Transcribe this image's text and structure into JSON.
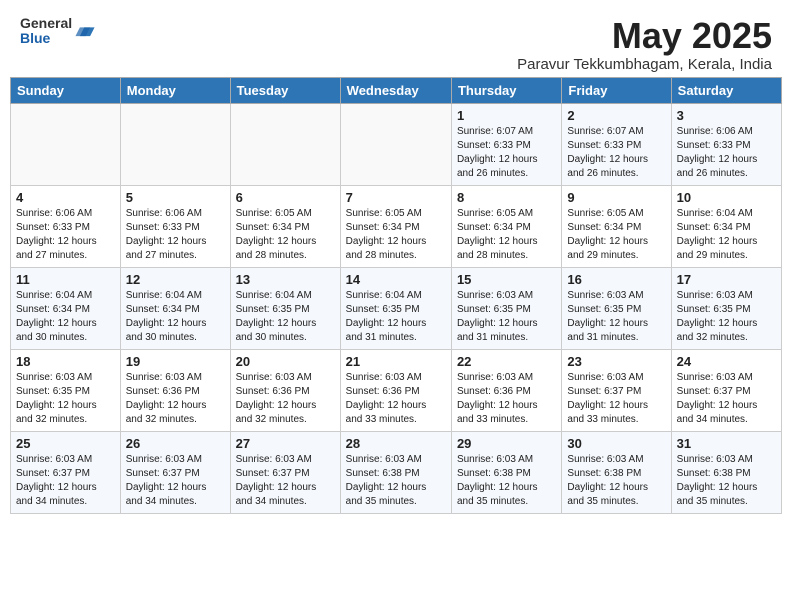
{
  "header": {
    "logo_general": "General",
    "logo_blue": "Blue",
    "month_year": "May 2025",
    "location": "Paravur Tekkumbhagam, Kerala, India"
  },
  "days_of_week": [
    "Sunday",
    "Monday",
    "Tuesday",
    "Wednesday",
    "Thursday",
    "Friday",
    "Saturday"
  ],
  "weeks": [
    [
      {
        "day": "",
        "info": ""
      },
      {
        "day": "",
        "info": ""
      },
      {
        "day": "",
        "info": ""
      },
      {
        "day": "",
        "info": ""
      },
      {
        "day": "1",
        "info": "Sunrise: 6:07 AM\nSunset: 6:33 PM\nDaylight: 12 hours\nand 26 minutes."
      },
      {
        "day": "2",
        "info": "Sunrise: 6:07 AM\nSunset: 6:33 PM\nDaylight: 12 hours\nand 26 minutes."
      },
      {
        "day": "3",
        "info": "Sunrise: 6:06 AM\nSunset: 6:33 PM\nDaylight: 12 hours\nand 26 minutes."
      }
    ],
    [
      {
        "day": "4",
        "info": "Sunrise: 6:06 AM\nSunset: 6:33 PM\nDaylight: 12 hours\nand 27 minutes."
      },
      {
        "day": "5",
        "info": "Sunrise: 6:06 AM\nSunset: 6:33 PM\nDaylight: 12 hours\nand 27 minutes."
      },
      {
        "day": "6",
        "info": "Sunrise: 6:05 AM\nSunset: 6:34 PM\nDaylight: 12 hours\nand 28 minutes."
      },
      {
        "day": "7",
        "info": "Sunrise: 6:05 AM\nSunset: 6:34 PM\nDaylight: 12 hours\nand 28 minutes."
      },
      {
        "day": "8",
        "info": "Sunrise: 6:05 AM\nSunset: 6:34 PM\nDaylight: 12 hours\nand 28 minutes."
      },
      {
        "day": "9",
        "info": "Sunrise: 6:05 AM\nSunset: 6:34 PM\nDaylight: 12 hours\nand 29 minutes."
      },
      {
        "day": "10",
        "info": "Sunrise: 6:04 AM\nSunset: 6:34 PM\nDaylight: 12 hours\nand 29 minutes."
      }
    ],
    [
      {
        "day": "11",
        "info": "Sunrise: 6:04 AM\nSunset: 6:34 PM\nDaylight: 12 hours\nand 30 minutes."
      },
      {
        "day": "12",
        "info": "Sunrise: 6:04 AM\nSunset: 6:34 PM\nDaylight: 12 hours\nand 30 minutes."
      },
      {
        "day": "13",
        "info": "Sunrise: 6:04 AM\nSunset: 6:35 PM\nDaylight: 12 hours\nand 30 minutes."
      },
      {
        "day": "14",
        "info": "Sunrise: 6:04 AM\nSunset: 6:35 PM\nDaylight: 12 hours\nand 31 minutes."
      },
      {
        "day": "15",
        "info": "Sunrise: 6:03 AM\nSunset: 6:35 PM\nDaylight: 12 hours\nand 31 minutes."
      },
      {
        "day": "16",
        "info": "Sunrise: 6:03 AM\nSunset: 6:35 PM\nDaylight: 12 hours\nand 31 minutes."
      },
      {
        "day": "17",
        "info": "Sunrise: 6:03 AM\nSunset: 6:35 PM\nDaylight: 12 hours\nand 32 minutes."
      }
    ],
    [
      {
        "day": "18",
        "info": "Sunrise: 6:03 AM\nSunset: 6:35 PM\nDaylight: 12 hours\nand 32 minutes."
      },
      {
        "day": "19",
        "info": "Sunrise: 6:03 AM\nSunset: 6:36 PM\nDaylight: 12 hours\nand 32 minutes."
      },
      {
        "day": "20",
        "info": "Sunrise: 6:03 AM\nSunset: 6:36 PM\nDaylight: 12 hours\nand 32 minutes."
      },
      {
        "day": "21",
        "info": "Sunrise: 6:03 AM\nSunset: 6:36 PM\nDaylight: 12 hours\nand 33 minutes."
      },
      {
        "day": "22",
        "info": "Sunrise: 6:03 AM\nSunset: 6:36 PM\nDaylight: 12 hours\nand 33 minutes."
      },
      {
        "day": "23",
        "info": "Sunrise: 6:03 AM\nSunset: 6:37 PM\nDaylight: 12 hours\nand 33 minutes."
      },
      {
        "day": "24",
        "info": "Sunrise: 6:03 AM\nSunset: 6:37 PM\nDaylight: 12 hours\nand 34 minutes."
      }
    ],
    [
      {
        "day": "25",
        "info": "Sunrise: 6:03 AM\nSunset: 6:37 PM\nDaylight: 12 hours\nand 34 minutes."
      },
      {
        "day": "26",
        "info": "Sunrise: 6:03 AM\nSunset: 6:37 PM\nDaylight: 12 hours\nand 34 minutes."
      },
      {
        "day": "27",
        "info": "Sunrise: 6:03 AM\nSunset: 6:37 PM\nDaylight: 12 hours\nand 34 minutes."
      },
      {
        "day": "28",
        "info": "Sunrise: 6:03 AM\nSunset: 6:38 PM\nDaylight: 12 hours\nand 35 minutes."
      },
      {
        "day": "29",
        "info": "Sunrise: 6:03 AM\nSunset: 6:38 PM\nDaylight: 12 hours\nand 35 minutes."
      },
      {
        "day": "30",
        "info": "Sunrise: 6:03 AM\nSunset: 6:38 PM\nDaylight: 12 hours\nand 35 minutes."
      },
      {
        "day": "31",
        "info": "Sunrise: 6:03 AM\nSunset: 6:38 PM\nDaylight: 12 hours\nand 35 minutes."
      }
    ]
  ]
}
